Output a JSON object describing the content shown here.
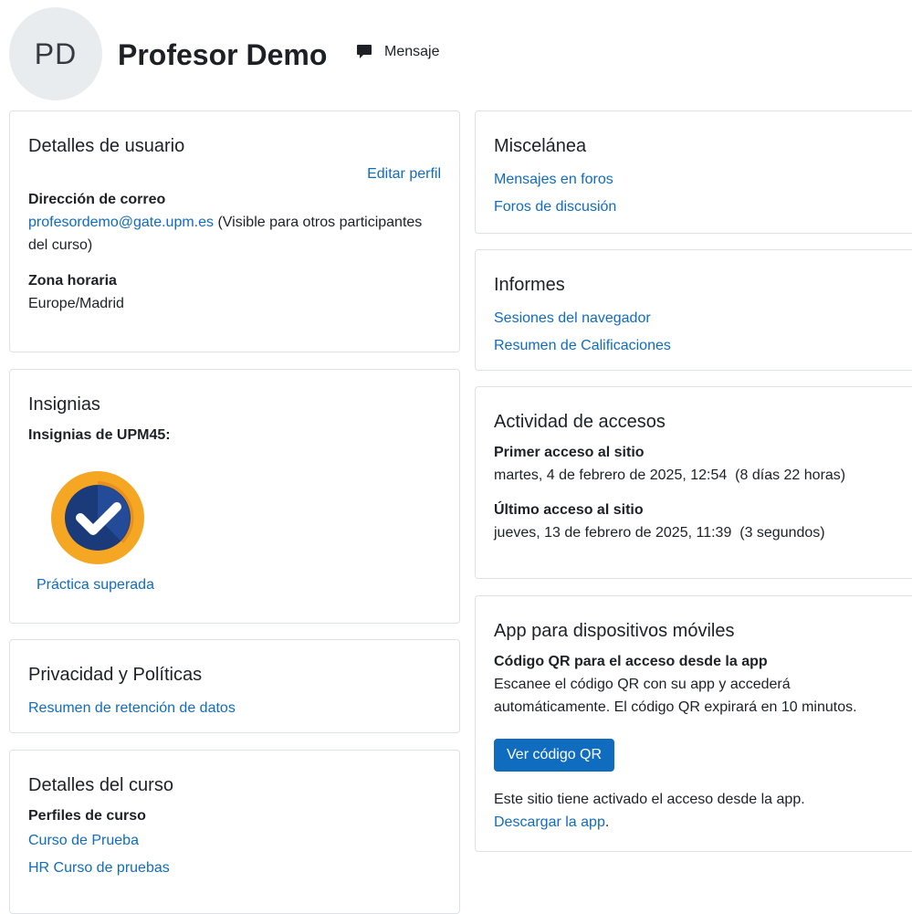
{
  "header": {
    "avatar_initials": "PD",
    "name": "Profesor Demo",
    "message_label": "Mensaje",
    "message_icon": "speech-bubble-icon"
  },
  "user_details": {
    "title": "Detalles de usuario",
    "edit_link": "Editar perfil",
    "email_label": "Dirección de correo",
    "email": "profesordemo@gate.upm.es",
    "email_note": "(Visible para otros participantes del curso)",
    "timezone_label": "Zona horaria",
    "timezone": "Europe/Madrid"
  },
  "badges": {
    "title": "Insignias",
    "subtitle": "Insignias de UPM45:",
    "items": [
      {
        "name": "Práctica superada",
        "icon": "checkmark-badge-icon",
        "colors": {
          "outer": "#f5a623",
          "inner": "#1b3a7a",
          "check": "#ffffff"
        }
      }
    ]
  },
  "privacy": {
    "title": "Privacidad y Políticas",
    "link": "Resumen de retención de datos"
  },
  "course": {
    "title": "Detalles del curso",
    "subtitle": "Perfiles de curso",
    "links": [
      "Curso de Prueba",
      "HR Curso de pruebas"
    ]
  },
  "misc": {
    "title": "Miscelánea",
    "links": [
      "Mensajes en foros",
      "Foros de discusión"
    ]
  },
  "reports": {
    "title": "Informes",
    "links": [
      "Sesiones del navegador",
      "Resumen de Calificaciones"
    ]
  },
  "access": {
    "title": "Actividad de accesos",
    "first_label": "Primer acceso al sitio",
    "first_value": "martes, 4 de febrero de 2025, 12:54  (8 días 22 horas)",
    "last_label": "Último acceso al sitio",
    "last_value": "jueves, 13 de febrero de 2025, 11:39  (3 segundos)"
  },
  "app": {
    "title": "App para dispositivos móviles",
    "qr_label": "Código QR para el acceso desde la app",
    "qr_desc": "Escanee el código QR con su app y accederá automáticamente. El código QR expirará en 10 minutos.",
    "button": "Ver código QR",
    "enabled_text": "Este sitio tiene activado el acceso desde la app.",
    "download_link": "Descargar la app",
    "download_suffix": "."
  },
  "colors": {
    "link": "#0f6cbf",
    "primary": "#0f6cbf",
    "border": "#dee2e6",
    "avatar_bg": "#e9ecef"
  }
}
